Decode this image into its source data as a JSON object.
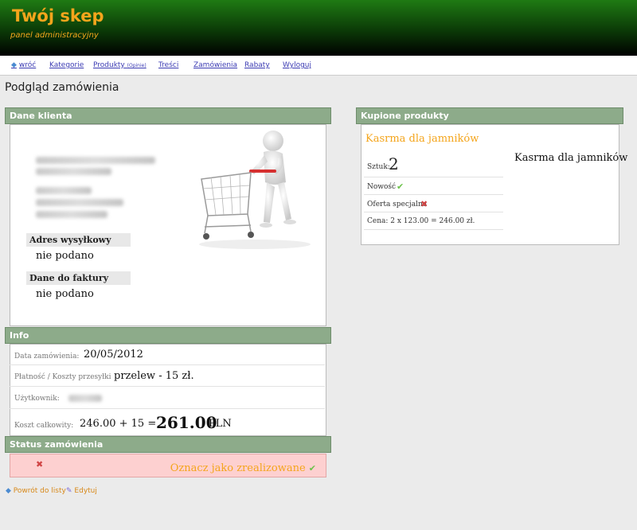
{
  "header": {
    "brand": "Twój skep",
    "tagline": "panel administracyjny"
  },
  "nav": {
    "back": "wróć",
    "categories": "Kategorie",
    "products": "Produkty",
    "products_sub": "(Opinie)",
    "contents": "Treści",
    "orders": "Zamówienia",
    "discounts": "Rabaty",
    "logout": "Wyloguj"
  },
  "page_title": "Podgląd zamówienia",
  "client": {
    "heading": "Dane klienta",
    "shipping_label": "Adres wysyłkowy",
    "shipping_value": "nie podano",
    "invoice_label": "Dane do faktury",
    "invoice_value": "nie podano"
  },
  "info": {
    "heading": "Info",
    "date_label": "Data zamówienia:",
    "date_value": "20/05/2012",
    "payment_label": "Płatność / Koszty przesyłki",
    "payment_value": "przelew - 15 zł.",
    "user_label": "Użytkownik:",
    "total_label": "Koszt całkowity:",
    "total_prefix": "246.00 + 15 =",
    "total_value": "261.00",
    "total_currency": "PLN"
  },
  "status": {
    "heading": "Status zamówienia",
    "x_icon": "✖",
    "mark_done": "Oznacz jako zrealizowane",
    "check_icon": "✔"
  },
  "footer": {
    "back_to_list": "Powrót do listy",
    "edit": "Edytuj"
  },
  "products": {
    "heading": "Kupione produkty",
    "item_name": "Kasrma dla jamników",
    "side_name": "Kasrma dla jamników",
    "qty_label": "Sztuk:",
    "qty_value": "2",
    "new_label": "Nowość",
    "special_label": "Oferta specjalna",
    "price_line": "Cena: 2 x 123.00 = 246.00 zł."
  },
  "colors": {
    "accent": "#f4a51c",
    "panel_head": "#8dab8a",
    "status_bg": "#fdd0d0",
    "link": "#3b3bb3"
  }
}
